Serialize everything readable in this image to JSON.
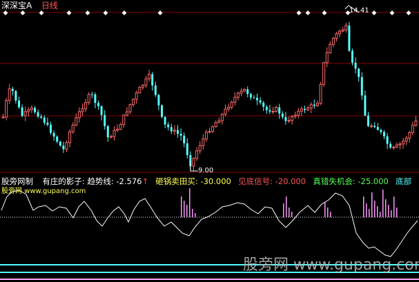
{
  "header": {
    "stock_name": "深深宝A",
    "period": "日线",
    "colors": {
      "stock_name": "#ffffff",
      "period": "#ff5555"
    }
  },
  "chart_data": [
    {
      "type": "candlestick",
      "annotations": {
        "high": "14.41",
        "low": "9.00"
      },
      "signal_marker": "◆",
      "colors": {
        "up": "#ff6a6a",
        "down": "#54ffff",
        "grid": "#8b0000",
        "annotation": "#ffffff"
      }
    },
    {
      "type": "line",
      "indicator_name": "股旁网制",
      "items": [
        {
          "label": "有庄的影子:",
          "value": "",
          "color": "#ffffff"
        },
        {
          "label": "趋势线:",
          "value": "-2.576",
          "arrow": "↑",
          "color": "#ffffff",
          "arrow_color": "#ff4040"
        },
        {
          "label": "砸锅卖田买:",
          "value": "-30.000",
          "color": "#ffff55"
        },
        {
          "label": "见底信号:",
          "value": "-20.000",
          "color": "#ff5555"
        },
        {
          "label": "真错失机会:",
          "value": "-25.000",
          "color": "#55ff55"
        },
        {
          "label": "底部",
          "value": "",
          "color": "#55ffff"
        }
      ],
      "watermark_small": "股旁网 www.gupang.com",
      "colors": {
        "line": "#ffffff",
        "bars": "#ff99ff",
        "baseline_dotted": "#ffffff",
        "level_cyan": "#55ffff",
        "level_pink": "#ffaaff"
      }
    }
  ],
  "watermark": "股旁网 www.gupang.com"
}
